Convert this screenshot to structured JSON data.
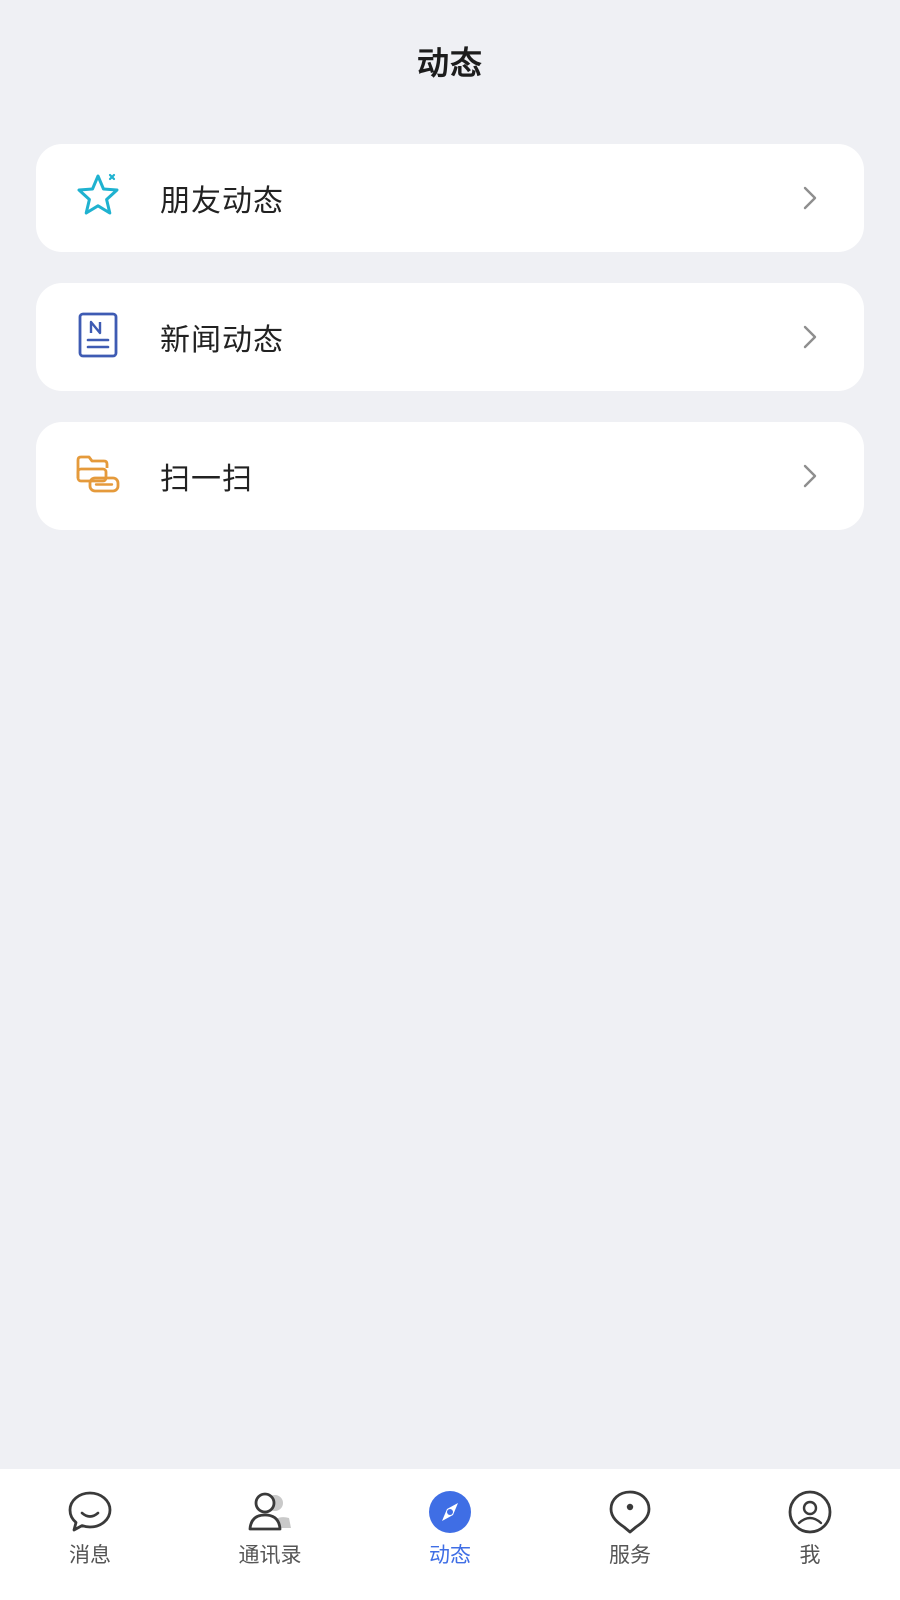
{
  "header": {
    "title": "动态"
  },
  "menu": {
    "items": [
      {
        "label": "朋友动态",
        "icon": "star-icon",
        "color": "#1fb2d0"
      },
      {
        "label": "新闻动态",
        "icon": "news-icon",
        "color": "#3e5bb3"
      },
      {
        "label": "扫一扫",
        "icon": "scan-icon",
        "color": "#e59a3b"
      }
    ]
  },
  "tabbar": {
    "active_color": "#3f6ee5",
    "items": [
      {
        "label": "消息",
        "icon": "chat-bubble-icon",
        "active": false
      },
      {
        "label": "通讯录",
        "icon": "contacts-icon",
        "active": false
      },
      {
        "label": "动态",
        "icon": "compass-icon",
        "active": true
      },
      {
        "label": "服务",
        "icon": "location-pin-icon",
        "active": false
      },
      {
        "label": "我",
        "icon": "profile-icon",
        "active": false
      }
    ]
  }
}
